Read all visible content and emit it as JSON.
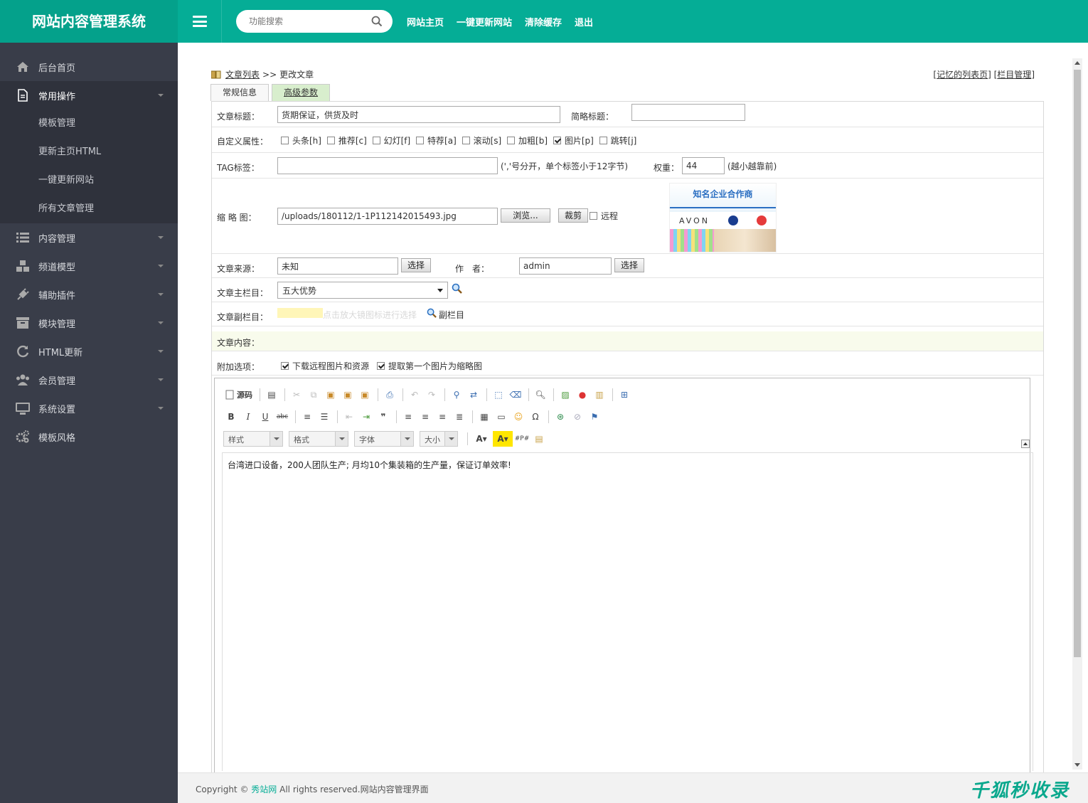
{
  "brand": "网站内容管理系统",
  "search": {
    "placeholder": "功能搜索"
  },
  "topnav": [
    "网站主页",
    "一键更新网站",
    "清除缓存",
    "退出"
  ],
  "sidebar": {
    "items": [
      {
        "label": "后台首页",
        "icon": "home-icon"
      },
      {
        "label": "常用操作",
        "icon": "document-icon",
        "expanded": true,
        "children": [
          "模板管理",
          "更新主页HTML",
          "一键更新网站",
          "所有文章管理"
        ]
      },
      {
        "label": "内容管理",
        "icon": "list-icon"
      },
      {
        "label": "频道模型",
        "icon": "cubes-icon"
      },
      {
        "label": "辅助插件",
        "icon": "plug-icon"
      },
      {
        "label": "模块管理",
        "icon": "archive-icon"
      },
      {
        "label": "HTML更新",
        "icon": "refresh-icon"
      },
      {
        "label": "会员管理",
        "icon": "users-icon"
      },
      {
        "label": "系统设置",
        "icon": "monitor-icon"
      },
      {
        "label": "模板风格",
        "icon": "cogs-icon"
      }
    ]
  },
  "breadcrumb": {
    "link": "文章列表",
    "sep": ">>",
    "current": "更改文章"
  },
  "rightlinks": {
    "a": "记忆的列表页",
    "b": "栏目管理"
  },
  "tabs": [
    "常规信息",
    "高级参数"
  ],
  "form": {
    "title_label": "文章标题：",
    "title_value": "货期保证，供货及时",
    "short_title_label": "简略标题：",
    "short_title_value": "",
    "flags_label": "自定义属性：",
    "flags": [
      {
        "label": "头条[h]",
        "checked": false
      },
      {
        "label": "推荐[c]",
        "checked": false
      },
      {
        "label": "幻灯[f]",
        "checked": false
      },
      {
        "label": "特荐[a]",
        "checked": false
      },
      {
        "label": "滚动[s]",
        "checked": false
      },
      {
        "label": "加粗[b]",
        "checked": false
      },
      {
        "label": "图片[p]",
        "checked": true
      },
      {
        "label": "跳转[j]",
        "checked": false
      }
    ],
    "tag_label": "TAG标签：",
    "tag_value": "",
    "tag_hint": "(','号分开，单个标签小于12字节)",
    "weight_label": "权重：",
    "weight_value": "44",
    "weight_hint": "(越小越靠前)",
    "thumb_label": "缩 略 图：",
    "thumb_value": "/uploads/180112/1-1P112142015493.jpg",
    "browse_btn": "浏览...",
    "crop_btn": "裁剪",
    "remote_label": "远程",
    "thumb_preview": {
      "title": "知名企业合作商",
      "brand": "AVON"
    },
    "source_label": "文章来源：",
    "source_value": "未知",
    "select_btn": "选择",
    "author_label": "作　者：",
    "author_value": "admin",
    "maincat_label": "文章主栏目：",
    "maincat_value": "五大优势",
    "subcat_label": "文章副栏目：",
    "subcat_hint": "点击放大镜图标进行选择",
    "subcat_link": "副栏目",
    "content_label": "文章内容：",
    "extra_label": "附加选项：",
    "extra_opts": [
      {
        "label": "下载远程图片和资源",
        "checked": true
      },
      {
        "label": "提取第一个图片为缩略图",
        "checked": true
      }
    ]
  },
  "editor": {
    "source_btn": "源码",
    "combos": [
      "样式",
      "格式",
      "字体",
      "大小"
    ],
    "content": "台湾进口设备，200人团队生产; 月均10个集装箱的生产量，保证订单效率!"
  },
  "footer": {
    "prefix": "Copyright ©",
    "site": "秀站网",
    "suffix": "All rights reserved.网站内容管理界面"
  },
  "watermark": "千狐秒收录",
  "colors": {
    "brand": "#05ad96",
    "sidebar": "#393d49"
  }
}
